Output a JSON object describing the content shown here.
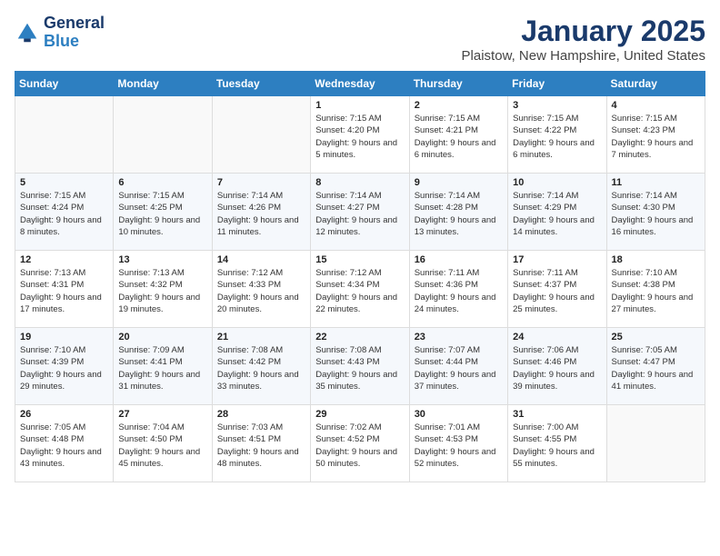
{
  "header": {
    "logo_general": "General",
    "logo_blue": "Blue",
    "month": "January 2025",
    "location": "Plaistow, New Hampshire, United States"
  },
  "weekdays": [
    "Sunday",
    "Monday",
    "Tuesday",
    "Wednesday",
    "Thursday",
    "Friday",
    "Saturday"
  ],
  "weeks": [
    [
      {
        "day": "",
        "sunrise": "",
        "sunset": "",
        "daylight": ""
      },
      {
        "day": "",
        "sunrise": "",
        "sunset": "",
        "daylight": ""
      },
      {
        "day": "",
        "sunrise": "",
        "sunset": "",
        "daylight": ""
      },
      {
        "day": "1",
        "sunrise": "Sunrise: 7:15 AM",
        "sunset": "Sunset: 4:20 PM",
        "daylight": "Daylight: 9 hours and 5 minutes."
      },
      {
        "day": "2",
        "sunrise": "Sunrise: 7:15 AM",
        "sunset": "Sunset: 4:21 PM",
        "daylight": "Daylight: 9 hours and 6 minutes."
      },
      {
        "day": "3",
        "sunrise": "Sunrise: 7:15 AM",
        "sunset": "Sunset: 4:22 PM",
        "daylight": "Daylight: 9 hours and 6 minutes."
      },
      {
        "day": "4",
        "sunrise": "Sunrise: 7:15 AM",
        "sunset": "Sunset: 4:23 PM",
        "daylight": "Daylight: 9 hours and 7 minutes."
      }
    ],
    [
      {
        "day": "5",
        "sunrise": "Sunrise: 7:15 AM",
        "sunset": "Sunset: 4:24 PM",
        "daylight": "Daylight: 9 hours and 8 minutes."
      },
      {
        "day": "6",
        "sunrise": "Sunrise: 7:15 AM",
        "sunset": "Sunset: 4:25 PM",
        "daylight": "Daylight: 9 hours and 10 minutes."
      },
      {
        "day": "7",
        "sunrise": "Sunrise: 7:14 AM",
        "sunset": "Sunset: 4:26 PM",
        "daylight": "Daylight: 9 hours and 11 minutes."
      },
      {
        "day": "8",
        "sunrise": "Sunrise: 7:14 AM",
        "sunset": "Sunset: 4:27 PM",
        "daylight": "Daylight: 9 hours and 12 minutes."
      },
      {
        "day": "9",
        "sunrise": "Sunrise: 7:14 AM",
        "sunset": "Sunset: 4:28 PM",
        "daylight": "Daylight: 9 hours and 13 minutes."
      },
      {
        "day": "10",
        "sunrise": "Sunrise: 7:14 AM",
        "sunset": "Sunset: 4:29 PM",
        "daylight": "Daylight: 9 hours and 14 minutes."
      },
      {
        "day": "11",
        "sunrise": "Sunrise: 7:14 AM",
        "sunset": "Sunset: 4:30 PM",
        "daylight": "Daylight: 9 hours and 16 minutes."
      }
    ],
    [
      {
        "day": "12",
        "sunrise": "Sunrise: 7:13 AM",
        "sunset": "Sunset: 4:31 PM",
        "daylight": "Daylight: 9 hours and 17 minutes."
      },
      {
        "day": "13",
        "sunrise": "Sunrise: 7:13 AM",
        "sunset": "Sunset: 4:32 PM",
        "daylight": "Daylight: 9 hours and 19 minutes."
      },
      {
        "day": "14",
        "sunrise": "Sunrise: 7:12 AM",
        "sunset": "Sunset: 4:33 PM",
        "daylight": "Daylight: 9 hours and 20 minutes."
      },
      {
        "day": "15",
        "sunrise": "Sunrise: 7:12 AM",
        "sunset": "Sunset: 4:34 PM",
        "daylight": "Daylight: 9 hours and 22 minutes."
      },
      {
        "day": "16",
        "sunrise": "Sunrise: 7:11 AM",
        "sunset": "Sunset: 4:36 PM",
        "daylight": "Daylight: 9 hours and 24 minutes."
      },
      {
        "day": "17",
        "sunrise": "Sunrise: 7:11 AM",
        "sunset": "Sunset: 4:37 PM",
        "daylight": "Daylight: 9 hours and 25 minutes."
      },
      {
        "day": "18",
        "sunrise": "Sunrise: 7:10 AM",
        "sunset": "Sunset: 4:38 PM",
        "daylight": "Daylight: 9 hours and 27 minutes."
      }
    ],
    [
      {
        "day": "19",
        "sunrise": "Sunrise: 7:10 AM",
        "sunset": "Sunset: 4:39 PM",
        "daylight": "Daylight: 9 hours and 29 minutes."
      },
      {
        "day": "20",
        "sunrise": "Sunrise: 7:09 AM",
        "sunset": "Sunset: 4:41 PM",
        "daylight": "Daylight: 9 hours and 31 minutes."
      },
      {
        "day": "21",
        "sunrise": "Sunrise: 7:08 AM",
        "sunset": "Sunset: 4:42 PM",
        "daylight": "Daylight: 9 hours and 33 minutes."
      },
      {
        "day": "22",
        "sunrise": "Sunrise: 7:08 AM",
        "sunset": "Sunset: 4:43 PM",
        "daylight": "Daylight: 9 hours and 35 minutes."
      },
      {
        "day": "23",
        "sunrise": "Sunrise: 7:07 AM",
        "sunset": "Sunset: 4:44 PM",
        "daylight": "Daylight: 9 hours and 37 minutes."
      },
      {
        "day": "24",
        "sunrise": "Sunrise: 7:06 AM",
        "sunset": "Sunset: 4:46 PM",
        "daylight": "Daylight: 9 hours and 39 minutes."
      },
      {
        "day": "25",
        "sunrise": "Sunrise: 7:05 AM",
        "sunset": "Sunset: 4:47 PM",
        "daylight": "Daylight: 9 hours and 41 minutes."
      }
    ],
    [
      {
        "day": "26",
        "sunrise": "Sunrise: 7:05 AM",
        "sunset": "Sunset: 4:48 PM",
        "daylight": "Daylight: 9 hours and 43 minutes."
      },
      {
        "day": "27",
        "sunrise": "Sunrise: 7:04 AM",
        "sunset": "Sunset: 4:50 PM",
        "daylight": "Daylight: 9 hours and 45 minutes."
      },
      {
        "day": "28",
        "sunrise": "Sunrise: 7:03 AM",
        "sunset": "Sunset: 4:51 PM",
        "daylight": "Daylight: 9 hours and 48 minutes."
      },
      {
        "day": "29",
        "sunrise": "Sunrise: 7:02 AM",
        "sunset": "Sunset: 4:52 PM",
        "daylight": "Daylight: 9 hours and 50 minutes."
      },
      {
        "day": "30",
        "sunrise": "Sunrise: 7:01 AM",
        "sunset": "Sunset: 4:53 PM",
        "daylight": "Daylight: 9 hours and 52 minutes."
      },
      {
        "day": "31",
        "sunrise": "Sunrise: 7:00 AM",
        "sunset": "Sunset: 4:55 PM",
        "daylight": "Daylight: 9 hours and 55 minutes."
      },
      {
        "day": "",
        "sunrise": "",
        "sunset": "",
        "daylight": ""
      }
    ]
  ]
}
